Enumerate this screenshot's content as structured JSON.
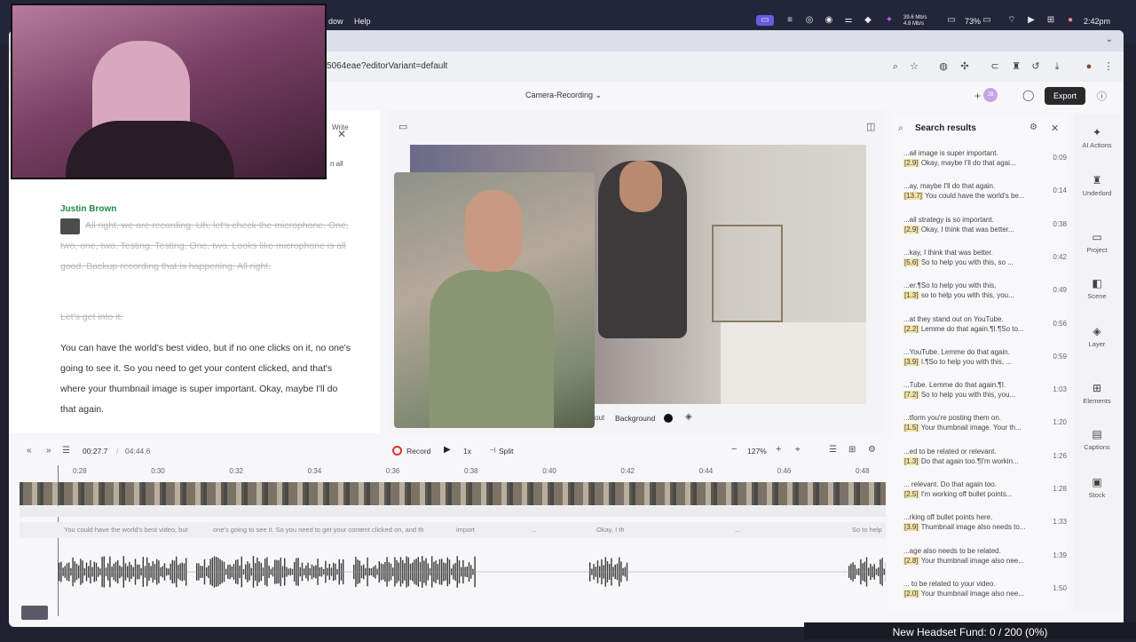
{
  "menubar": {
    "menu_window": "dow",
    "menu_help": "Help",
    "net_up": "39.6 Mb/s",
    "net_down": "4.8 Mb/s",
    "battery": "73%",
    "clock": "2:42pm"
  },
  "browser": {
    "url": "5064eae?editorVariant=default"
  },
  "app": {
    "project_name": "Camera-Recording",
    "export_label": "Export",
    "collab_initial": "JB",
    "write_label": "Write",
    "notice_fragment": "n all"
  },
  "transcript": {
    "speaker": "Justin Brown",
    "struck_paragraph": "All right, we are recording. Uh, let's check the microphone. One, two, one, two. Testing. Testing. One, two. Looks like microphone is all good. Backup recording that is happening. All right.",
    "struck_line": "Let's get into it.",
    "active_paragraph": "You can have the world's best video, but if no one clicks on it, no one's going to see it. So you need to get your content clicked, and that's where your thumbnail image is super important. Okay, maybe I'll do that again."
  },
  "preview": {
    "layout_fragment": "out",
    "background_label": "Background"
  },
  "search": {
    "title": "Search results",
    "results": [
      {
        "l1": "...ail image is super important.",
        "badge": "[2.9]",
        "l2": "Okay, maybe I'll do that agai...",
        "time": "0:09"
      },
      {
        "l1": "...ay, maybe I'll do that again.",
        "badge": "[13.7]",
        "l2": "You could have the world's be...",
        "time": "0:14"
      },
      {
        "l1": "...ail strategy is so important.",
        "badge": "[2.9]",
        "l2": "Okay, I think that was better...",
        "time": "0:38"
      },
      {
        "l1": "...kay, I think that was better.",
        "badge": "[5.6]",
        "l2": "So to help you with this, so ...",
        "time": "0:42"
      },
      {
        "l1": "...er.¶So to help you with this,",
        "badge": "[1.3]",
        "l2": "so to help you with this, you...",
        "time": "0:49"
      },
      {
        "l1": "...at they stand out on YouTube.",
        "badge": "[2.2]",
        "l2": "Lemme do that again.¶I.¶So to...",
        "time": "0:56"
      },
      {
        "l1": "...YouTube. Lemme do that again.",
        "badge": "[3.9]",
        "l2": "I.¶So to help you with this, ...",
        "time": "0:59"
      },
      {
        "l1": "...Tube. Lemme do that again.¶I.",
        "badge": "[7.2]",
        "l2": "So to help you with this, you...",
        "time": "1:03"
      },
      {
        "l1": "...tform you're posting them on.",
        "badge": "[1.5]",
        "l2": "Your thumbnail image. Your th...",
        "time": "1:20"
      },
      {
        "l1": "...ed to be related or relevant.",
        "badge": "[1.3]",
        "l2": "Do that again too.¶I'm workin...",
        "time": "1:26"
      },
      {
        "l1": "... relevant. Do that again too.",
        "badge": "[2.5]",
        "l2": "I'm working off bullet points...",
        "time": "1:28"
      },
      {
        "l1": "...rking off bullet points here.",
        "badge": "[3.9]",
        "l2": "Thumbnail image also needs to...",
        "time": "1:33"
      },
      {
        "l1": "...age also needs to be related.",
        "badge": "[2.8]",
        "l2": "Your thumbnail image also nee...",
        "time": "1:39"
      },
      {
        "l1": "... to be related to your video.",
        "badge": "[2.0]",
        "l2": "Your thumbnail image also nee...",
        "time": "1:50"
      }
    ]
  },
  "sidebar": [
    {
      "label": "AI Actions",
      "icon": "sparkle-icon"
    },
    {
      "label": "Underlord",
      "icon": "robot-icon"
    },
    {
      "label": "Project",
      "icon": "folder-icon"
    },
    {
      "label": "Scene",
      "icon": "scene-icon"
    },
    {
      "label": "Layer",
      "icon": "layers-icon"
    },
    {
      "label": "Elements",
      "icon": "elements-icon"
    },
    {
      "label": "Captions",
      "icon": "captions-icon"
    },
    {
      "label": "Stock",
      "icon": "stock-icon"
    }
  ],
  "timeline": {
    "current_time": "00:27.7",
    "total_time": "04:44.6",
    "record_label": "Record",
    "speed_label": "1x",
    "split_label": "Split",
    "zoom_label": "127%",
    "ticks": [
      "0:28",
      "0:30",
      "0:32",
      "0:34",
      "0:36",
      "0:38",
      "0:40",
      "0:42",
      "0:44",
      "0:46",
      "0:48"
    ],
    "captions": [
      "You could have the world's best video, but",
      "one's going to see it. So you need to get your content clicked on, and th",
      "import",
      "...",
      "Okay, I th",
      "...",
      "So to help"
    ]
  },
  "overlay": {
    "fund_text": "New Headset Fund:  0 / 200 (0%)",
    "fund_progress": 0
  }
}
